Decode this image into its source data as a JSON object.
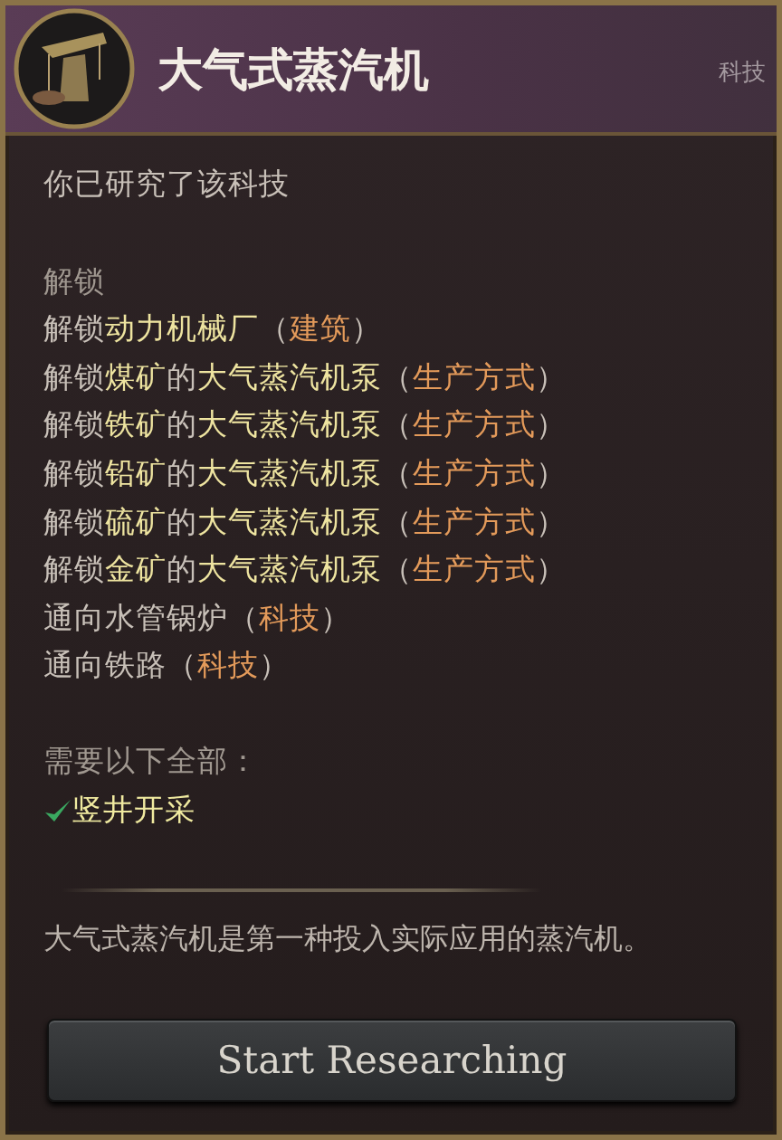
{
  "header": {
    "title": "大气式蒸汽机",
    "category": "科技"
  },
  "status": "你已研究了该科技",
  "unlocks": {
    "heading": "解锁",
    "lines": [
      [
        {
          "text": "解锁",
          "kind": "plain"
        },
        {
          "text": "动力机械厂",
          "kind": "name"
        },
        {
          "text": "（",
          "kind": "plain"
        },
        {
          "text": "建筑",
          "kind": "type"
        },
        {
          "text": "）",
          "kind": "plain"
        }
      ],
      [
        {
          "text": "解锁",
          "kind": "plain"
        },
        {
          "text": "煤矿",
          "kind": "name"
        },
        {
          "text": "的",
          "kind": "plain"
        },
        {
          "text": "大气蒸汽机泵",
          "kind": "name"
        },
        {
          "text": "（",
          "kind": "plain"
        },
        {
          "text": "生产方式",
          "kind": "type"
        },
        {
          "text": "）",
          "kind": "plain"
        }
      ],
      [
        {
          "text": "解锁",
          "kind": "plain"
        },
        {
          "text": "铁矿",
          "kind": "name"
        },
        {
          "text": "的",
          "kind": "plain"
        },
        {
          "text": "大气蒸汽机泵",
          "kind": "name"
        },
        {
          "text": "（",
          "kind": "plain"
        },
        {
          "text": "生产方式",
          "kind": "type"
        },
        {
          "text": "）",
          "kind": "plain"
        }
      ],
      [
        {
          "text": "解锁",
          "kind": "plain"
        },
        {
          "text": "铅矿",
          "kind": "name"
        },
        {
          "text": "的",
          "kind": "plain"
        },
        {
          "text": "大气蒸汽机泵",
          "kind": "name"
        },
        {
          "text": "（",
          "kind": "plain"
        },
        {
          "text": "生产方式",
          "kind": "type"
        },
        {
          "text": "）",
          "kind": "plain"
        }
      ],
      [
        {
          "text": "解锁",
          "kind": "plain"
        },
        {
          "text": "硫矿",
          "kind": "name"
        },
        {
          "text": "的",
          "kind": "plain"
        },
        {
          "text": "大气蒸汽机泵",
          "kind": "name"
        },
        {
          "text": "（",
          "kind": "plain"
        },
        {
          "text": "生产方式",
          "kind": "type"
        },
        {
          "text": "）",
          "kind": "plain"
        }
      ],
      [
        {
          "text": "解锁",
          "kind": "plain"
        },
        {
          "text": "金矿",
          "kind": "name"
        },
        {
          "text": "的",
          "kind": "plain"
        },
        {
          "text": "大气蒸汽机泵",
          "kind": "name"
        },
        {
          "text": "（",
          "kind": "plain"
        },
        {
          "text": "生产方式",
          "kind": "type"
        },
        {
          "text": "）",
          "kind": "plain"
        }
      ],
      [
        {
          "text": "通向水管锅炉",
          "kind": "plain"
        },
        {
          "text": "（",
          "kind": "plain"
        },
        {
          "text": "科技",
          "kind": "type"
        },
        {
          "text": "）",
          "kind": "plain"
        }
      ],
      [
        {
          "text": "通向铁路",
          "kind": "plain"
        },
        {
          "text": "（",
          "kind": "plain"
        },
        {
          "text": "科技",
          "kind": "type"
        },
        {
          "text": "）",
          "kind": "plain"
        }
      ]
    ]
  },
  "requirements": {
    "heading": "需要以下全部：",
    "items": [
      {
        "label": "竖井开采",
        "met": true
      }
    ]
  },
  "description": "大气式蒸汽机是第一种投入实际应用的蒸汽机。",
  "button": {
    "label": "Start Researching"
  }
}
